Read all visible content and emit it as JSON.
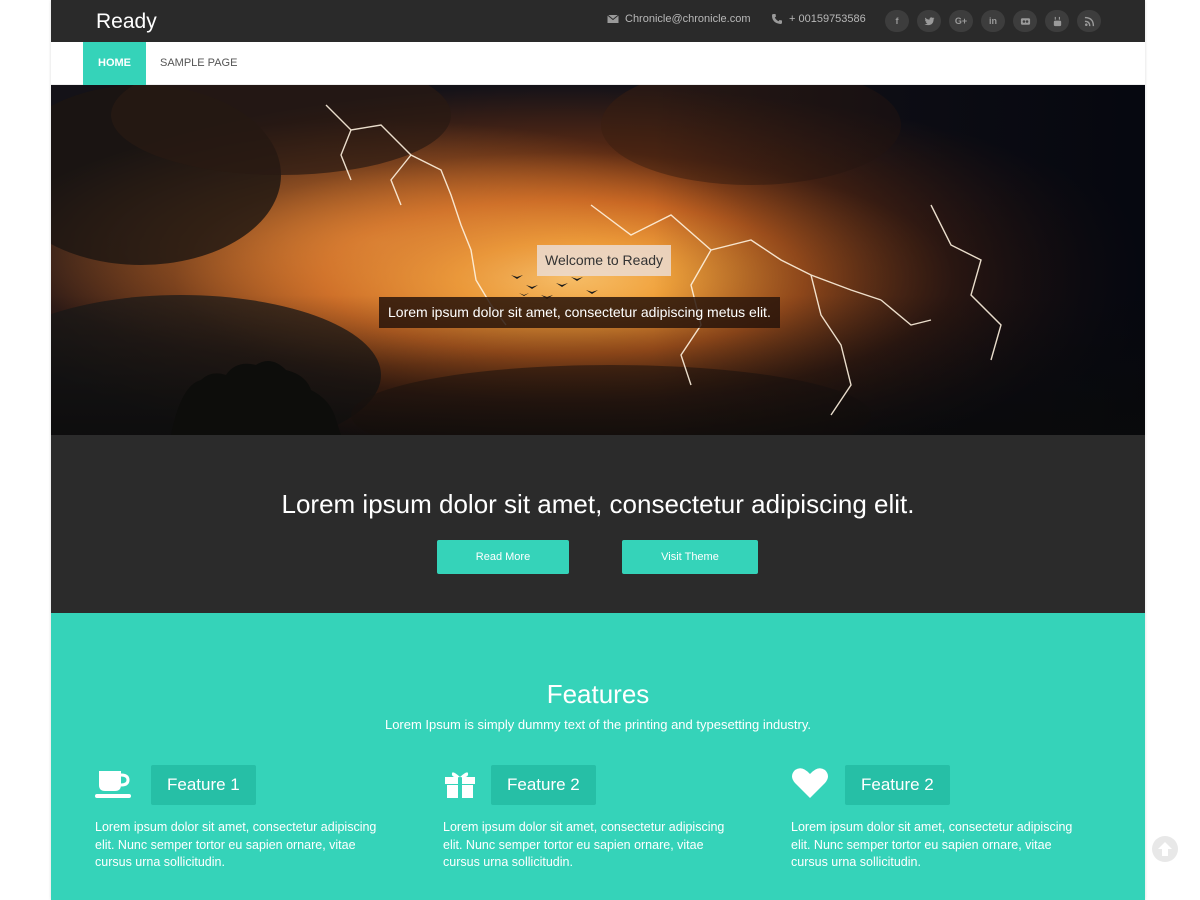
{
  "site": {
    "title": "Ready"
  },
  "contact": {
    "email": "Chronicle@chronicle.com",
    "phone": "+ 00159753586"
  },
  "socials": [
    {
      "icon": "facebook-icon",
      "glyph": "f"
    },
    {
      "icon": "twitter-icon",
      "glyph": "t"
    },
    {
      "icon": "google-plus-icon",
      "glyph": "G+"
    },
    {
      "icon": "linkedin-icon",
      "glyph": "in"
    },
    {
      "icon": "flickr-icon",
      "glyph": "••"
    },
    {
      "icon": "youtube-icon",
      "glyph": "▶"
    },
    {
      "icon": "rss-icon",
      "glyph": "rss"
    }
  ],
  "nav": {
    "items": [
      "HOME",
      "SAMPLE PAGE"
    ],
    "active": "HOME"
  },
  "hero": {
    "caption_title": "Welcome to Ready",
    "caption_text": "Lorem ipsum dolor sit amet, consectetur adipiscing metus elit."
  },
  "banner": {
    "text": "Lorem ipsum dolor sit amet, consectetur adipiscing elit.",
    "buttons": [
      "Read More",
      "Visit Theme"
    ]
  },
  "features": {
    "title": "Features",
    "subtitle": "Lorem Ipsum is simply dummy text of the printing and typesetting industry.",
    "items": [
      {
        "label": "Feature 1",
        "icon": "coffee-cup-icon",
        "text": "Lorem ipsum dolor sit amet, consectetur adipiscing elit. Nunc semper tortor eu sapien ornare, vitae cursus urna sollicitudin."
      },
      {
        "label": "Feature 2",
        "icon": "gift-icon",
        "text": "Lorem ipsum dolor sit amet, consectetur adipiscing elit. Nunc semper tortor eu sapien ornare, vitae cursus urna sollicitudin."
      },
      {
        "label": "Feature 2",
        "icon": "heart-icon",
        "text": "Lorem ipsum dolor sit amet, consectetur adipiscing elit. Nunc semper tortor eu sapien ornare, vitae cursus urna sollicitudin."
      }
    ]
  },
  "colors": {
    "accent": "#35d3b9",
    "dark": "#2b2b2b",
    "label_bg": "#26bfa6"
  }
}
